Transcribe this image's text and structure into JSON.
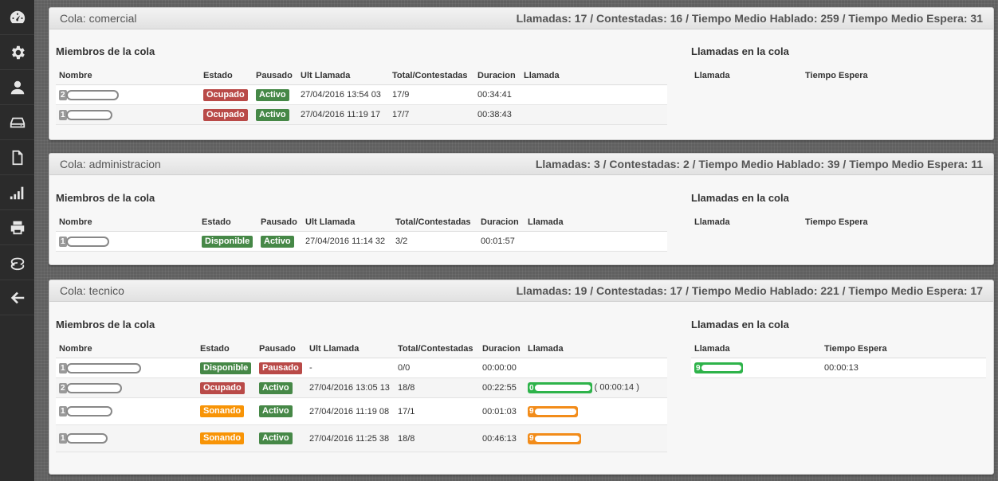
{
  "sidebar": {
    "items": [
      {
        "icon": "dashboard-icon"
      },
      {
        "icon": "gear-icon"
      },
      {
        "icon": "user-icon"
      },
      {
        "icon": "hard-drive-icon"
      },
      {
        "icon": "document-icon"
      },
      {
        "icon": "signal-bars-icon"
      },
      {
        "icon": "printer-icon"
      },
      {
        "icon": "sync-icon"
      },
      {
        "icon": "arrow-left-icon"
      }
    ]
  },
  "labels": {
    "members_title": "Miembros de la cola",
    "calls_title": "Llamadas en la cola",
    "member_cols": [
      "Nombre",
      "Estado",
      "Pausado",
      "Ult Llamada",
      "Total/Contestadas",
      "Duracion",
      "Llamada"
    ],
    "call_cols": [
      "Llamada",
      "Tiempo Espera"
    ]
  },
  "colors": {
    "danger": "#b94a48",
    "success": "#468847",
    "warning": "#f89406",
    "call_green": "#2eb34a",
    "call_orange": "#f28c1a"
  },
  "queues": [
    {
      "name": "Cola: comercial",
      "stats": "Llamadas: 17 / Contestadas: 16 / Tiempo Medio Hablado: 259 / Tiempo Medio Espera: 31",
      "members": [
        {
          "num": "2",
          "estado": "Ocupado",
          "pausado": "Activo",
          "ult": "27/04/2016 13:54 03",
          "total": "17/9",
          "duracion": "00:34:41"
        },
        {
          "num": "1",
          "estado": "Ocupado",
          "pausado": "Activo",
          "ult": "27/04/2016 11:19 17",
          "total": "17/7",
          "duracion": "00:38:43"
        }
      ],
      "calls": []
    },
    {
      "name": "Cola: administracion",
      "stats": "Llamadas: 3 / Contestadas: 2 / Tiempo Medio Hablado: 39 / Tiempo Medio Espera: 11",
      "members": [
        {
          "num": "1",
          "estado": "Disponible",
          "pausado": "Activo",
          "ult": "27/04/2016 11:14 32",
          "total": "3/2",
          "duracion": "00:01:57"
        }
      ],
      "calls": []
    },
    {
      "name": "Cola: tecnico",
      "stats": "Llamadas: 19 / Contestadas: 17 / Tiempo Medio Hablado: 221 / Tiempo Medio Espera: 17",
      "members": [
        {
          "num": "1",
          "estado": "Disponible",
          "pausado": "Pausado",
          "ult": "-",
          "total": "0/0",
          "duracion": "00:00:00"
        },
        {
          "num": "2",
          "estado": "Ocupado",
          "pausado": "Activo",
          "ult": "27/04/2016 13:05 13",
          "total": "18/8",
          "duracion": "00:22:55",
          "llamada_num": "0",
          "llamada_time": "( 00:00:14 )"
        },
        {
          "num": "1",
          "estado": "Sonando",
          "pausado": "Activo",
          "ult": "27/04/2016 11:19 08",
          "total": "17/1",
          "duracion": "00:01:03",
          "llamada_num": "9"
        },
        {
          "num": "1",
          "estado": "Sonando",
          "pausado": "Activo",
          "ult": "27/04/2016 11:25 38",
          "total": "18/8",
          "duracion": "00:46:13",
          "llamada_num": "9"
        }
      ],
      "calls": [
        {
          "num": "9",
          "espera": "00:00:13"
        }
      ]
    }
  ]
}
